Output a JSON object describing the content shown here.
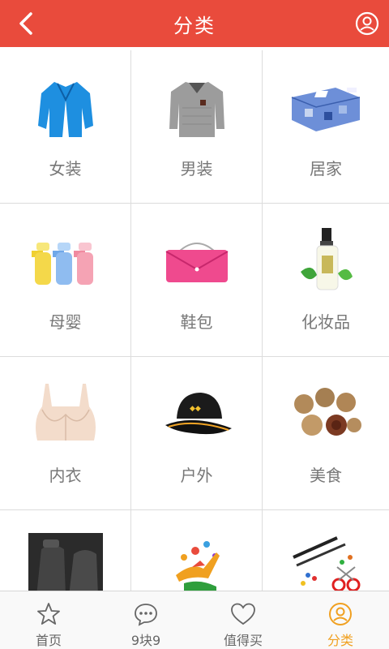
{
  "header": {
    "title": "分类"
  },
  "categories": [
    {
      "label": "女装",
      "icon": "cardigan-image"
    },
    {
      "label": "男装",
      "icon": "sweater-image"
    },
    {
      "label": "居家",
      "icon": "bedding-image"
    },
    {
      "label": "母婴",
      "icon": "baby-bottles-image"
    },
    {
      "label": "鞋包",
      "icon": "handbag-image"
    },
    {
      "label": "化妆品",
      "icon": "cosmetic-bottle-image"
    },
    {
      "label": "内衣",
      "icon": "bra-image"
    },
    {
      "label": "户外",
      "icon": "cap-image"
    },
    {
      "label": "美食",
      "icon": "nuts-image"
    },
    {
      "label": "",
      "icon": "car-seat-image"
    },
    {
      "label": "",
      "icon": "sports-logo-image"
    },
    {
      "label": "",
      "icon": "office-supplies-image"
    }
  ],
  "tabbar": {
    "tabs": [
      {
        "label": "首页",
        "icon": "star-icon"
      },
      {
        "label": "9块9",
        "icon": "chat-bubble-icon"
      },
      {
        "label": "值得买",
        "icon": "heart-icon"
      },
      {
        "label": "分类",
        "icon": "user-circle-icon"
      }
    ],
    "active_color": "#f0a020",
    "inactive_color": "#666666"
  },
  "colors": {
    "header_bg": "#e94b3c",
    "label": "#777777"
  }
}
